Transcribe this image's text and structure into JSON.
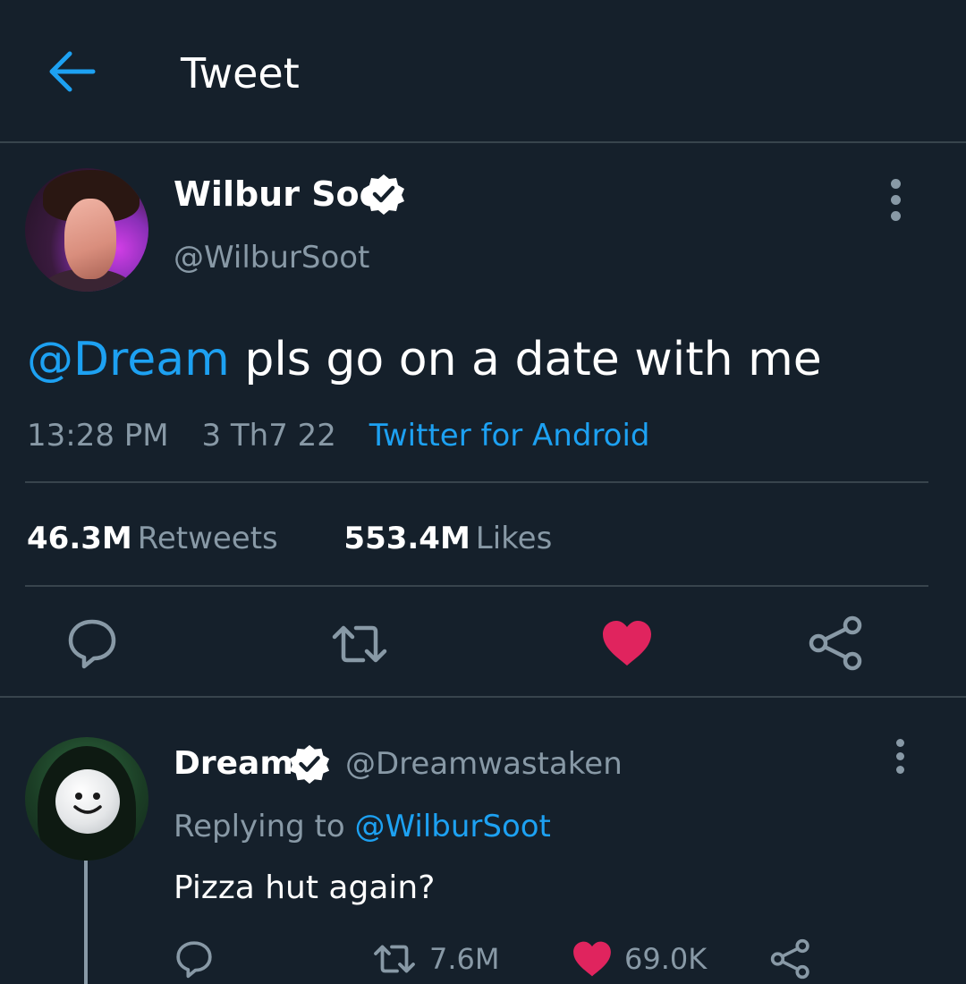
{
  "header": {
    "title": "Tweet",
    "back_icon": "arrow-left-icon"
  },
  "colors": {
    "background": "#15202b",
    "accent": "#1da1f2",
    "like": "#e0245e",
    "secondary_text": "#8899a6",
    "border": "#38444d"
  },
  "tweet": {
    "author_name": "Wilbur Soot",
    "author_handle": "@WilburSoot",
    "verified": true,
    "text_mention": "@Dream",
    "text_body": "pls go on a date with me",
    "time": "13:28 PM",
    "date": "3 Th7 22",
    "source": "Twitter for Android",
    "retweets_count": "46.3M",
    "retweets_label": "Retweets",
    "likes_count": "553.4M",
    "likes_label": "Likes",
    "liked": true,
    "actions": [
      "reply-icon",
      "retweet-icon",
      "heart-icon",
      "share-icon"
    ]
  },
  "reply": {
    "author_name": "Dream",
    "author_handle": "@Dreamwastaken",
    "verified": true,
    "replying_label": "Replying to",
    "replying_handle": "@WilburSoot",
    "text": "Pizza hut again?",
    "retweets_count": "7.6M",
    "likes_count": "69.0K",
    "liked": true
  }
}
